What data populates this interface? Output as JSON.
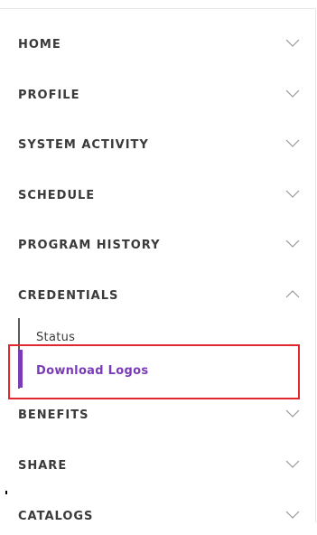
{
  "nav": {
    "items": [
      {
        "label": "HOME",
        "expanded": false,
        "icon": "chevron-down-icon"
      },
      {
        "label": "PROFILE",
        "expanded": false,
        "icon": "chevron-down-icon"
      },
      {
        "label": "SYSTEM ACTIVITY",
        "expanded": false,
        "icon": "chevron-down-icon"
      },
      {
        "label": "SCHEDULE",
        "expanded": false,
        "icon": "chevron-down-icon"
      },
      {
        "label": "PROGRAM HISTORY",
        "expanded": false,
        "icon": "chevron-down-icon"
      },
      {
        "label": "CREDENTIALS",
        "expanded": true,
        "icon": "chevron-up-icon"
      },
      {
        "label": "BENEFITS",
        "expanded": false,
        "icon": "chevron-down-icon"
      },
      {
        "label": "SHARE",
        "expanded": false,
        "icon": "chevron-down-icon"
      },
      {
        "label": "CATALOGS",
        "expanded": false,
        "icon": "chevron-down-icon"
      }
    ],
    "credentials_submenu": [
      {
        "label": "Status",
        "active": false
      },
      {
        "label": "Download Logos",
        "active": true
      }
    ]
  },
  "colors": {
    "accent": "#7a3bb8",
    "text": "#3a3a3a",
    "highlight": "#e0282e"
  }
}
